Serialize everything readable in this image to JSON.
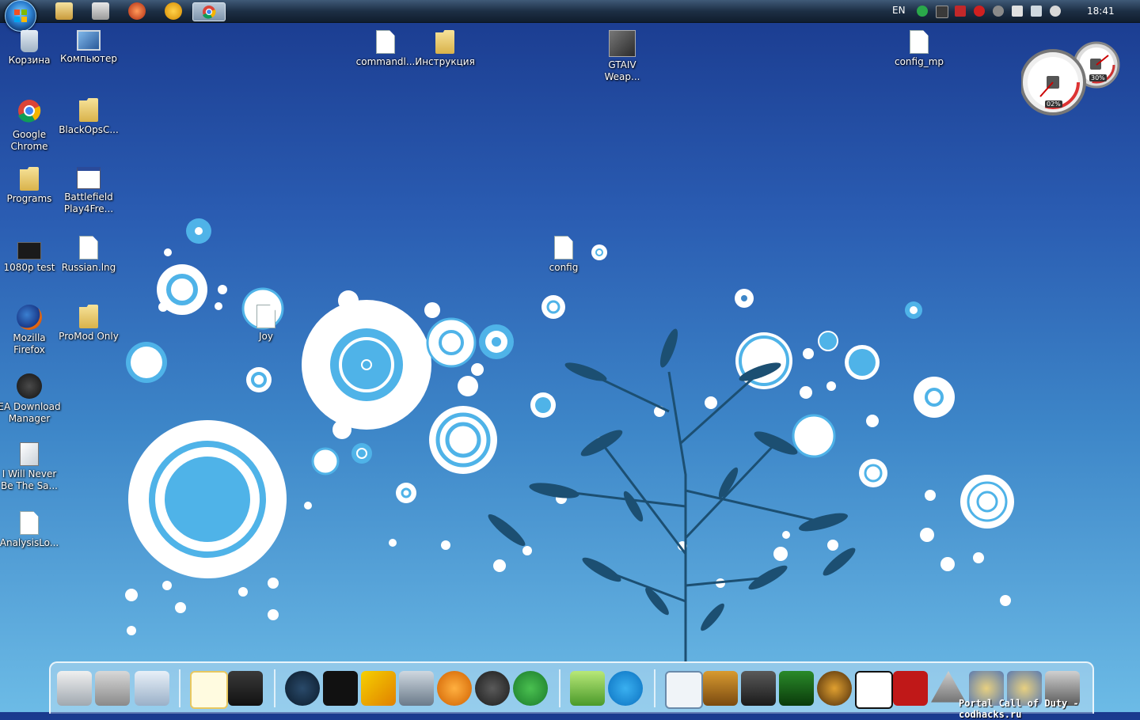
{
  "taskbar": {
    "language": "EN",
    "clock": "18:41"
  },
  "desktop": {
    "icons": [
      {
        "label": "Корзина"
      },
      {
        "label": "Компьютер"
      },
      {
        "label": "Google Chrome"
      },
      {
        "label": "BlackOpsC..."
      },
      {
        "label": "Programs"
      },
      {
        "label": "Battlefield Play4Fre..."
      },
      {
        "label": "1080p test"
      },
      {
        "label": "Russian.lng"
      },
      {
        "label": "Mozilla Firefox"
      },
      {
        "label": "ProMod Only"
      },
      {
        "label": "EA Download Manager"
      },
      {
        "label": "I Will Never Be The Sa..."
      },
      {
        "label": "AnalysisLo..."
      },
      {
        "label": "commandl..."
      },
      {
        "label": "Инструкция"
      },
      {
        "label": "GTAIV Weap..."
      },
      {
        "label": "config_mp"
      },
      {
        "label": "config"
      },
      {
        "label": "Joy"
      }
    ]
  },
  "gadget": {
    "cpu_percent": "02%",
    "memory_percent": "30%"
  },
  "dock": {
    "watermark": "Portal Call of Duty - codhacks.ru"
  },
  "colors": {
    "accent": "#4fb3e8",
    "tree": "#1c4f72"
  }
}
